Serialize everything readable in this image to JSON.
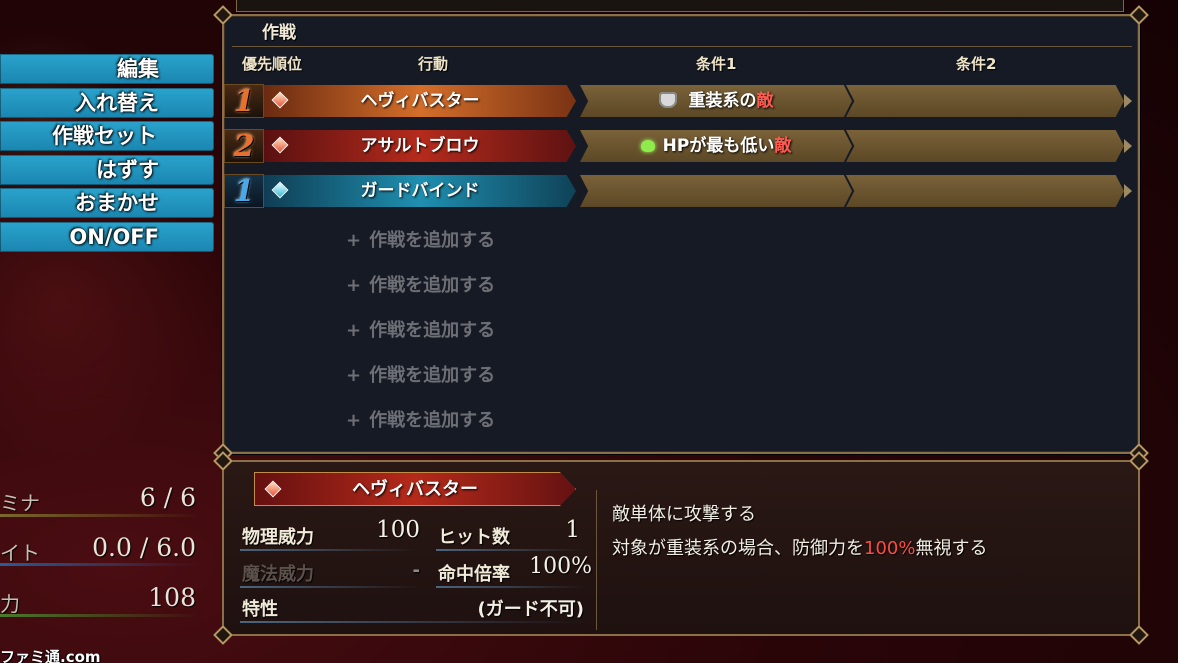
{
  "menu": {
    "items": [
      "編集",
      "入れ替え",
      "作戦セット",
      "はずす",
      "おまかせ",
      "ON/OFF"
    ]
  },
  "panel": {
    "title": "作戦",
    "headers": {
      "priority": "優先順位",
      "action": "行動",
      "cond1": "条件1",
      "cond2": "条件2"
    },
    "rows": [
      {
        "priority": "1",
        "action": "ヘヴィバスター",
        "cond1_icon": "armor-icon",
        "cond1_prefix": "重装系の",
        "cond1_enemy": "敵",
        "cond2": ""
      },
      {
        "priority": "2",
        "action": "アサルトブロウ",
        "cond1_icon": "heart-icon",
        "cond1_prefix": "HPが最も低い",
        "cond1_enemy": "敵",
        "cond2": ""
      },
      {
        "priority": "1",
        "action": "ガードバインド",
        "cond1": "",
        "cond2": ""
      }
    ],
    "add_slot": {
      "plus": "+",
      "label": "作戦を追加する"
    }
  },
  "skill": {
    "name": "ヘヴィバスター",
    "phys_label": "物理威力",
    "phys_value": "100",
    "hits_label": "ヒット数",
    "hits_value": "1",
    "magic_label": "魔法威力",
    "magic_value": "-",
    "accuracy_label": "命中倍率",
    "accuracy_value": "100%",
    "trait_label": "特性",
    "trait_value": "(ガード不可)",
    "desc_line1": "敵単体に攻撃する",
    "desc_line2_a": "対象が重装系の場合、防御力を",
    "desc_line2_hl": "100%",
    "desc_line2_b": "無視する"
  },
  "status": {
    "stamina_label": "ミナ",
    "stamina_value": "6 / 6",
    "weight_label": "イト",
    "weight_value": "0.0 / 6.0",
    "power_label": "力",
    "power_value": "108"
  },
  "watermark": "ファミ通.com",
  "colors": {
    "menu_blue": "#1a86b0",
    "action_orange": "#d46e2a",
    "action_red": "#b52b1c",
    "action_blue": "#1f8fb0",
    "enemy_red": "#ff5a52",
    "frame_gold": "#8a6f48"
  }
}
